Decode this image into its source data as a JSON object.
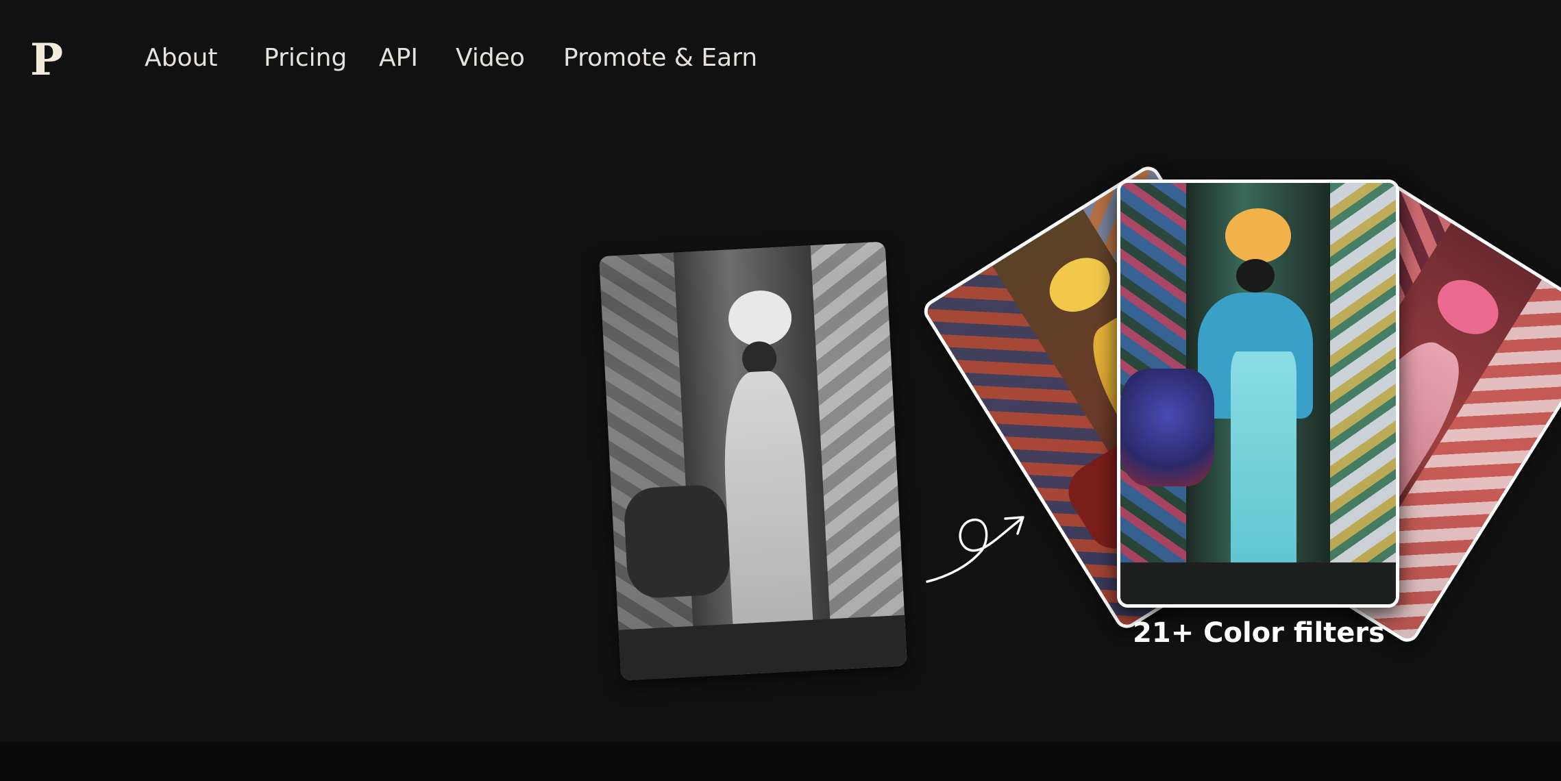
{
  "header": {
    "logo": "P",
    "nav": [
      "About",
      "Pricing",
      "API",
      "Video",
      "Promote & Earn"
    ]
  },
  "hero": {
    "caption": "21+ Color filters",
    "before_photo": "grayscale-portrait-photo",
    "after_photos": [
      "warm-colorized-photo",
      "teal-colorized-photo",
      "red-colorized-photo"
    ],
    "arrow_icon": "curly-arrow-icon"
  },
  "colors": {
    "background": "#121112",
    "logo": "#f3ecdc",
    "nav_text": "#e6e3df",
    "caption": "#ffffff",
    "card_border": "#ffffff"
  }
}
